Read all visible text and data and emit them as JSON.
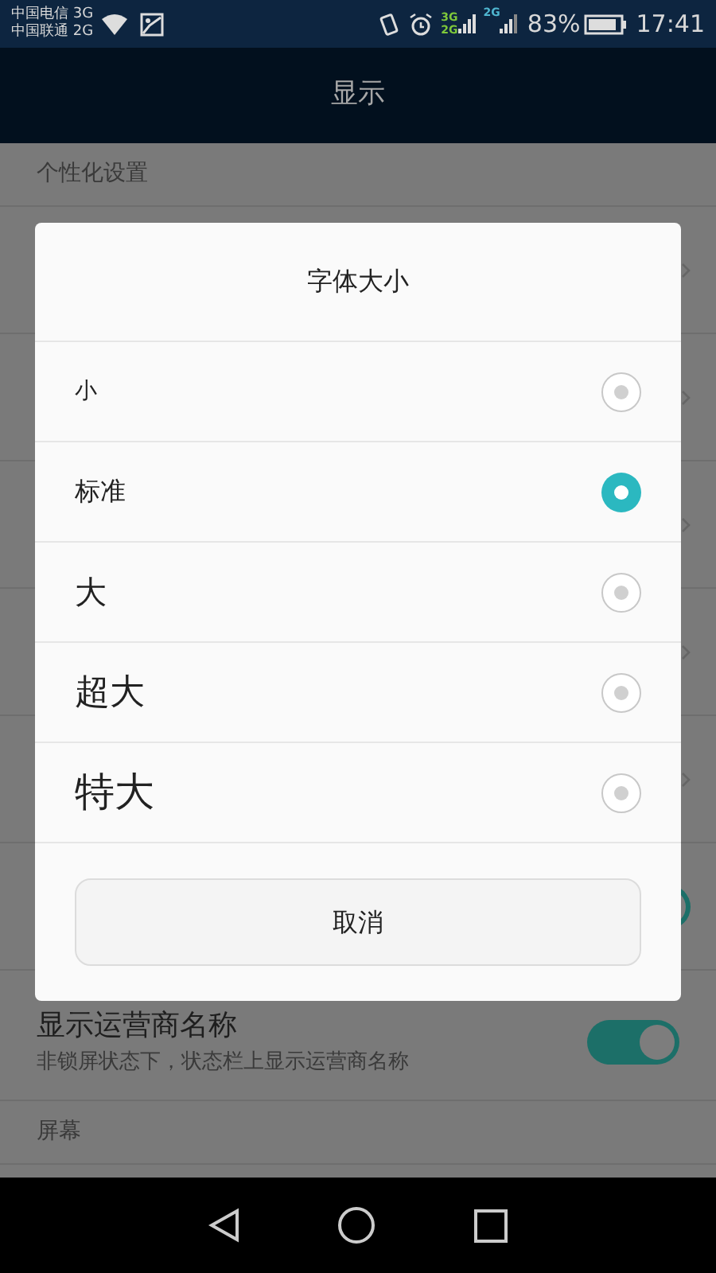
{
  "status_bar": {
    "carriers": [
      "中国电信 3G",
      "中国联通 2G"
    ],
    "sim1_network": [
      "3G",
      "2G"
    ],
    "sim2_network": "2G",
    "battery": "83%",
    "time": "17:41"
  },
  "header": {
    "title": "显示"
  },
  "section": "个性化设置",
  "hidden_rows": [
    {
      "kind": "chevron"
    },
    {
      "kind": "chevron"
    },
    {
      "kind": "chevron"
    },
    {
      "kind": "chevron"
    },
    {
      "kind": "chevron"
    },
    {
      "kind": "toggle",
      "on": true
    }
  ],
  "carrier_row": {
    "title": "显示运营商名称",
    "subtitle": "非锁屏状态下，状态栏上显示运营商名称",
    "on": true
  },
  "section2": "屏幕",
  "dialog": {
    "title": "字体大小",
    "options": [
      {
        "label": "小",
        "selected": false
      },
      {
        "label": "标准",
        "selected": true
      },
      {
        "label": "大",
        "selected": false
      },
      {
        "label": "超大",
        "selected": false
      },
      {
        "label": "特大",
        "selected": false
      }
    ],
    "cancel": "取消"
  }
}
